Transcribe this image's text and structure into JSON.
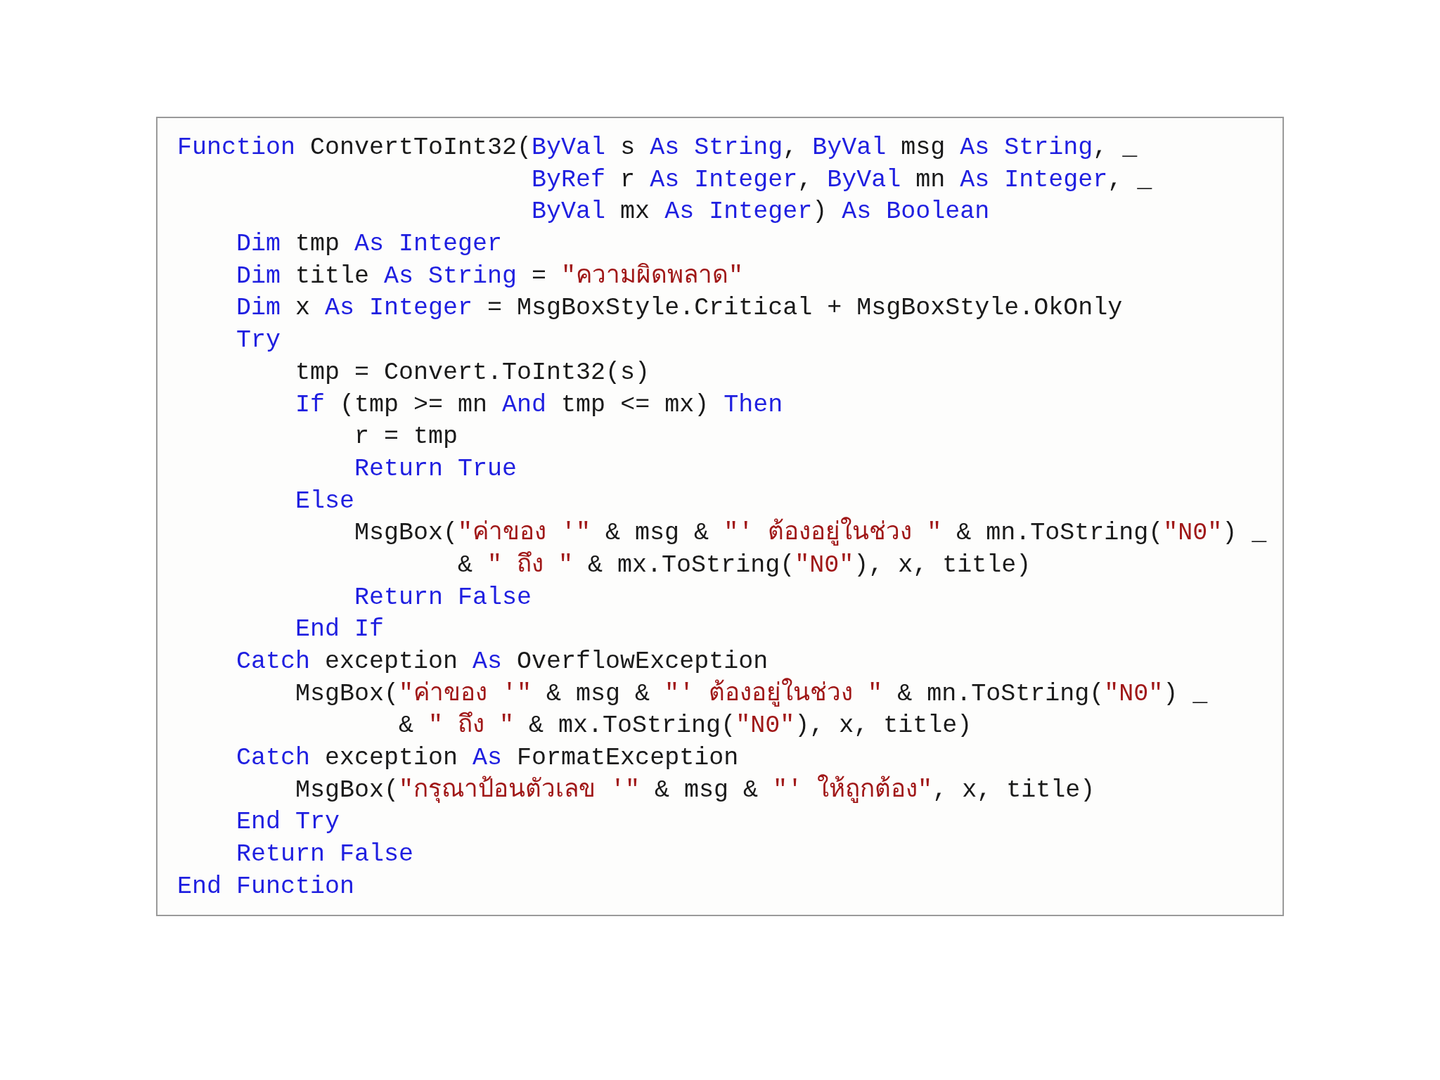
{
  "code_listing": {
    "lines": [
      [
        {
          "kind": "keyword",
          "t": "Function"
        },
        {
          "kind": "plain",
          "t": " ConvertToInt32("
        },
        {
          "kind": "keyword",
          "t": "ByVal"
        },
        {
          "kind": "plain",
          "t": " s "
        },
        {
          "kind": "keyword",
          "t": "As String"
        },
        {
          "kind": "plain",
          "t": ", "
        },
        {
          "kind": "keyword",
          "t": "ByVal"
        },
        {
          "kind": "plain",
          "t": " msg "
        },
        {
          "kind": "keyword",
          "t": "As String"
        },
        {
          "kind": "plain",
          "t": ", _"
        }
      ],
      [
        {
          "kind": "keyword",
          "t": "                        ByRef"
        },
        {
          "kind": "plain",
          "t": " r "
        },
        {
          "kind": "keyword",
          "t": "As Integer"
        },
        {
          "kind": "plain",
          "t": ", "
        },
        {
          "kind": "keyword",
          "t": "ByVal"
        },
        {
          "kind": "plain",
          "t": " mn "
        },
        {
          "kind": "keyword",
          "t": "As Integer"
        },
        {
          "kind": "plain",
          "t": ", _"
        }
      ],
      [
        {
          "kind": "keyword",
          "t": "                        ByVal"
        },
        {
          "kind": "plain",
          "t": " mx "
        },
        {
          "kind": "keyword",
          "t": "As Integer"
        },
        {
          "kind": "plain",
          "t": ") "
        },
        {
          "kind": "keyword",
          "t": "As Boolean"
        }
      ],
      [
        {
          "kind": "keyword",
          "t": "    Dim"
        },
        {
          "kind": "plain",
          "t": " tmp "
        },
        {
          "kind": "keyword",
          "t": "As Integer"
        }
      ],
      [
        {
          "kind": "keyword",
          "t": "    Dim"
        },
        {
          "kind": "plain",
          "t": " title "
        },
        {
          "kind": "keyword",
          "t": "As String"
        },
        {
          "kind": "plain",
          "t": " = "
        },
        {
          "kind": "string",
          "t": "\"ความผิดพลาด\""
        }
      ],
      [
        {
          "kind": "keyword",
          "t": "    Dim"
        },
        {
          "kind": "plain",
          "t": " x "
        },
        {
          "kind": "keyword",
          "t": "As Integer"
        },
        {
          "kind": "plain",
          "t": " = MsgBoxStyle.Critical + MsgBoxStyle.OkOnly"
        }
      ],
      [
        {
          "kind": "keyword",
          "t": "    Try"
        }
      ],
      [
        {
          "kind": "plain",
          "t": "        tmp = Convert.ToInt32(s)"
        }
      ],
      [
        {
          "kind": "keyword",
          "t": "        If"
        },
        {
          "kind": "plain",
          "t": " (tmp >= mn "
        },
        {
          "kind": "keyword",
          "t": "And"
        },
        {
          "kind": "plain",
          "t": " tmp <= mx) "
        },
        {
          "kind": "keyword",
          "t": "Then"
        }
      ],
      [
        {
          "kind": "plain",
          "t": "            r = tmp"
        }
      ],
      [
        {
          "kind": "keyword",
          "t": "            Return True"
        }
      ],
      [
        {
          "kind": "keyword",
          "t": "        Else"
        }
      ],
      [
        {
          "kind": "plain",
          "t": "            MsgBox("
        },
        {
          "kind": "string",
          "t": "\"ค่าของ '\""
        },
        {
          "kind": "plain",
          "t": " & msg & "
        },
        {
          "kind": "string",
          "t": "\"' ต้องอยู่ในช่วง \""
        },
        {
          "kind": "plain",
          "t": " & mn.ToString("
        },
        {
          "kind": "string",
          "t": "\"N0\""
        },
        {
          "kind": "plain",
          "t": ") _"
        }
      ],
      [
        {
          "kind": "plain",
          "t": "                   & "
        },
        {
          "kind": "string",
          "t": "\" ถึง \""
        },
        {
          "kind": "plain",
          "t": " & mx.ToString("
        },
        {
          "kind": "string",
          "t": "\"N0\""
        },
        {
          "kind": "plain",
          "t": "), x, title)"
        }
      ],
      [
        {
          "kind": "keyword",
          "t": "            Return False"
        }
      ],
      [
        {
          "kind": "keyword",
          "t": "        End If"
        }
      ],
      [
        {
          "kind": "keyword",
          "t": "    Catch"
        },
        {
          "kind": "plain",
          "t": " exception "
        },
        {
          "kind": "keyword",
          "t": "As"
        },
        {
          "kind": "plain",
          "t": " OverflowException"
        }
      ],
      [
        {
          "kind": "plain",
          "t": "        MsgBox("
        },
        {
          "kind": "string",
          "t": "\"ค่าของ '\""
        },
        {
          "kind": "plain",
          "t": " & msg & "
        },
        {
          "kind": "string",
          "t": "\"' ต้องอยู่ในช่วง \""
        },
        {
          "kind": "plain",
          "t": " & mn.ToString("
        },
        {
          "kind": "string",
          "t": "\"N0\""
        },
        {
          "kind": "plain",
          "t": ") _"
        }
      ],
      [
        {
          "kind": "plain",
          "t": "               & "
        },
        {
          "kind": "string",
          "t": "\" ถึง \""
        },
        {
          "kind": "plain",
          "t": " & mx.ToString("
        },
        {
          "kind": "string",
          "t": "\"N0\""
        },
        {
          "kind": "plain",
          "t": "), x, title)"
        }
      ],
      [
        {
          "kind": "keyword",
          "t": "    Catch"
        },
        {
          "kind": "plain",
          "t": " exception "
        },
        {
          "kind": "keyword",
          "t": "As"
        },
        {
          "kind": "plain",
          "t": " FormatException"
        }
      ],
      [
        {
          "kind": "plain",
          "t": "        MsgBox("
        },
        {
          "kind": "string",
          "t": "\"กรุณาป้อนตัวเลข '\""
        },
        {
          "kind": "plain",
          "t": " & msg & "
        },
        {
          "kind": "string",
          "t": "\"' ให้ถูกต้อง\""
        },
        {
          "kind": "plain",
          "t": ", x, title)"
        }
      ],
      [
        {
          "kind": "keyword",
          "t": "    End Try"
        }
      ],
      [
        {
          "kind": "keyword",
          "t": "    Return False"
        }
      ],
      [
        {
          "kind": "keyword",
          "t": "End Function"
        }
      ]
    ]
  }
}
